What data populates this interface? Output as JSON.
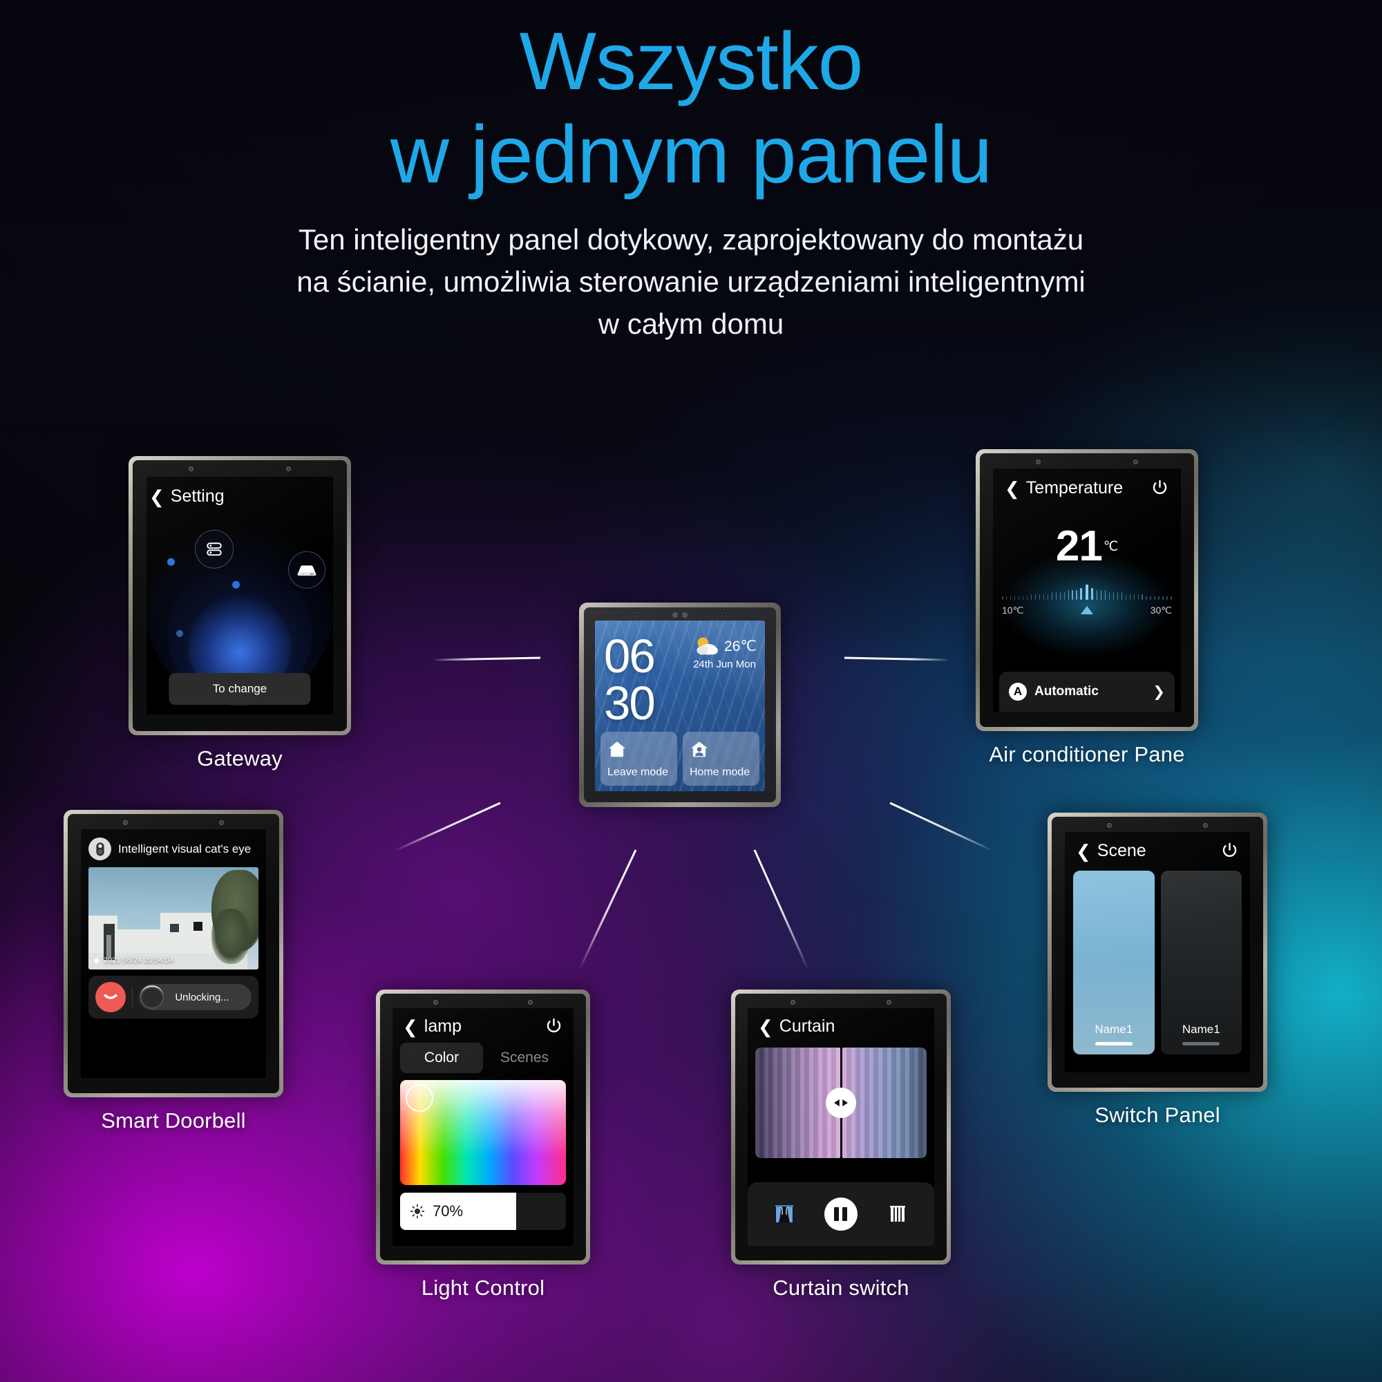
{
  "header": {
    "title_line1": "Wszystko",
    "title_line2": "w jednym panelu",
    "subtitle_line1": "Ten inteligentny panel dotykowy, zaprojektowany do montażu",
    "subtitle_line2": "na ścianie, umożliwia sterowanie urządzeniami inteligentnymi",
    "subtitle_line3": "w całym domu",
    "accent_color": "#1fa8e8"
  },
  "devices": {
    "gateway": {
      "caption": "Gateway",
      "screen_title": "Setting",
      "button_label": "To change"
    },
    "home": {
      "clock_hours": "06",
      "clock_minutes": "30",
      "weather_temp": "26℃",
      "weather_date": "24th Jun  Mon",
      "mode_leave": "Leave mode",
      "mode_home": "Home mode"
    },
    "air_conditioner": {
      "caption": "Air conditioner Pane",
      "screen_title": "Temperature",
      "value": "21",
      "unit": "℃",
      "scale_min": "10℃",
      "scale_max": "30℃",
      "mode_badge": "A",
      "mode_label": "Automatic"
    },
    "doorbell": {
      "caption": "Smart Doorbell",
      "screen_title": "Intelligent visual cat's eye",
      "video_timestamp": "2021 06/24 20:04:04",
      "unlock_label": "Unlocking..."
    },
    "light": {
      "caption": "Light Control",
      "screen_title": "lamp",
      "tab_color": "Color",
      "tab_scenes": "Scenes",
      "brightness": "70%",
      "brightness_value": 70
    },
    "curtain": {
      "caption": "Curtain switch",
      "screen_title": "Curtain"
    },
    "switch_panel": {
      "caption": "Switch Panel",
      "screen_title": "Scene",
      "button1_name": "Name1",
      "button2_name": "Name1"
    }
  }
}
